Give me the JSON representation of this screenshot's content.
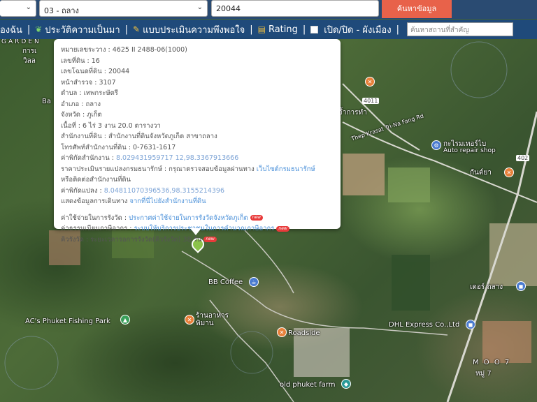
{
  "search": {
    "province_value": "",
    "district_value": "03 - ถลาง",
    "parcel_value": "20044",
    "search_button": "ค้นหาข้อมูล"
  },
  "nav": {
    "item1": "องฉัน",
    "item2": "ประวัติความเป็นมา",
    "item3": "แบบประเมินความพึงพอใจ",
    "item4": "Rating",
    "item5": "เปิด/ปิด - ผังเมือง",
    "place_placeholder": "ค้นหาสถานที่สำคัญ"
  },
  "popup": {
    "map_sheet": "หมายเลขระวาง : 4625 II 2488-06(1000)",
    "land_no": "เลขที่ดิน : 16",
    "deed_no": "เลขโฉนดที่ดิน : 20044",
    "survey_page": "หน้าสำรวจ : 3107",
    "subdistrict": "ตำบล : เทพกระษัตรี",
    "district": "อำเภอ : ถลาง",
    "province": "จังหวัด : ภูเก็ต",
    "area": "เนื้อที่ : 6 ไร่ 3 งาน 20.0 ตารางวา",
    "land_office": "สำนักงานที่ดิน : สำนักงานที่ดินจังหวัดภูเก็ต สาขาถลาง",
    "office_phone": "โทรศัพท์สำนักงานที่ดิน : 0-7631-1617",
    "office_coord_label": "ค่าพิกัดสำนักงาน : ",
    "office_coord_value": "8.029431959717 12,98.3367913666",
    "appraisal_label": "ราคาประเมินรายแปลงกรมธนารักษ์ : กรุณาตรวจสอบข้อมูลผ่านทาง ",
    "appraisal_link": "เว็บไซต์กรมธนารักษ์",
    "appraisal_contact": "หรือติดต่อสำนักงานที่ดิน",
    "parcel_coord_label": "ค่าพิกัดแปลง : ",
    "parcel_coord_value": "8.04811070396536,98.3155214396",
    "route_label": "แสดงข้อมูลการเดินทาง ",
    "route_link": "จากที่นี่ไปยังสำนักงานที่ดิน",
    "fee_label": "ค่าใช้จ่ายในการรังวัด : ",
    "fee_link": "ประกาศค่าใช้จ่ายในการรังวัดจังหวัดภูเก็ต",
    "tax_label": "ค่าธรรมเนียมภาษีอากร : ",
    "tax_link": "ระบบให้บริการประชาชนในการคำนวณภาษีอากร",
    "queue_label": "คิวรังวัด : ระยะเวลารอการรังวัด(คิวรังวัด) 38 วัน",
    "new_badge": "new"
  },
  "map": {
    "labels": {
      "garden": "GARDEN",
      "baan_partial": "Ba",
      "bb_coffee": "BB Coffee",
      "acs_fishing": "AC's Phuket Fishing Park",
      "roadside": "Roadside",
      "dhl": "DHL Express Co.,Ltd",
      "old_farm": "old phuket farm",
      "auto_repair_th": "กะไรมเทอร์ไบ",
      "auto_repair_en": "Auto repair shop",
      "road_name": "Thep Krasat Tri-Na Fang Rd",
      "moo7_en": "M O O 7",
      "moo7_th": "หมู่ 7",
      "thalang_store": "เดอร์ ถลาง",
      "restaurant_th": "น้ำจิ้มยาย ",
      "food_th": "จ้ำการทำ",
      "road_4011": "4011",
      "road_402": "402",
      "cafe_th": "ร้านอาหาร พิมาน",
      "kanlaya": "กันต์ยา",
      "wila": "วิลล",
      "karn": "การเ"
    }
  },
  "colors": {
    "topbar": "#2a4b72",
    "navbar": "#1f4a7a",
    "search_button": "#e8624a",
    "link": "#4a90d9",
    "new_badge": "#e83a3a"
  }
}
